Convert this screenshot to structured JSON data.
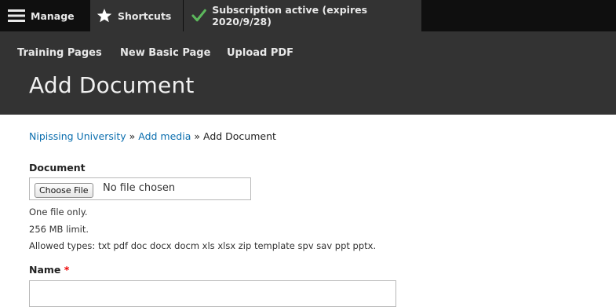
{
  "toolbar": {
    "manage_label": "Manage",
    "shortcuts_label": "Shortcuts",
    "subscription_label": "Subscription active (expires 2020/9/28)"
  },
  "tray": {
    "links": [
      "Training Pages",
      "New Basic Page",
      "Upload PDF"
    ]
  },
  "page": {
    "title": "Add Document"
  },
  "breadcrumb": {
    "home": "Nipissing University",
    "sep": "»",
    "media": "Add media",
    "current": "Add Document"
  },
  "form": {
    "document_label": "Document",
    "file_button": "Choose File",
    "file_status": "No file chosen",
    "help_one": "One file only.",
    "help_limit": "256 MB limit.",
    "help_types": "Allowed types: txt pdf doc docx docm xls xlsx zip template spv sav ppt pptx.",
    "name_label": "Name",
    "required_marker": "*",
    "name_value": ""
  },
  "colors": {
    "toolbar": "#0f0f0f",
    "tray": "#333333",
    "link": "#0b6eae",
    "check": "#5cb85c",
    "required": "#ee0000"
  }
}
